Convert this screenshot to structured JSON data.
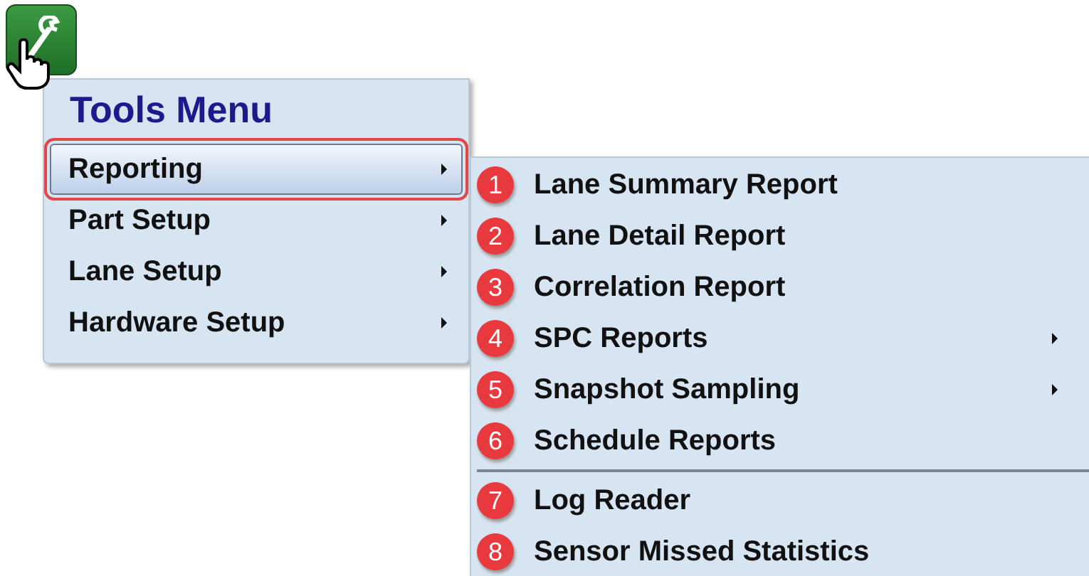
{
  "tools_button": {
    "pressed": true
  },
  "menu": {
    "title": "Tools Menu",
    "items": [
      {
        "label": "Reporting",
        "selected": true,
        "has_submenu": true
      },
      {
        "label": "Part Setup",
        "selected": false,
        "has_submenu": true
      },
      {
        "label": "Lane Setup",
        "selected": false,
        "has_submenu": true
      },
      {
        "label": "Hardware Setup",
        "selected": false,
        "has_submenu": true
      }
    ]
  },
  "submenu": {
    "groups": [
      [
        {
          "badge": "1",
          "label": "Lane Summary Report",
          "has_submenu": false
        },
        {
          "badge": "2",
          "label": "Lane Detail Report",
          "has_submenu": false
        },
        {
          "badge": "3",
          "label": "Correlation Report",
          "has_submenu": false
        },
        {
          "badge": "4",
          "label": "SPC Reports",
          "has_submenu": true
        },
        {
          "badge": "5",
          "label": "Snapshot Sampling",
          "has_submenu": true
        },
        {
          "badge": "6",
          "label": "Schedule Reports",
          "has_submenu": false
        }
      ],
      [
        {
          "badge": "7",
          "label": "Log Reader",
          "has_submenu": false
        },
        {
          "badge": "8",
          "label": "Sensor Missed Statistics",
          "has_submenu": false
        }
      ]
    ]
  }
}
